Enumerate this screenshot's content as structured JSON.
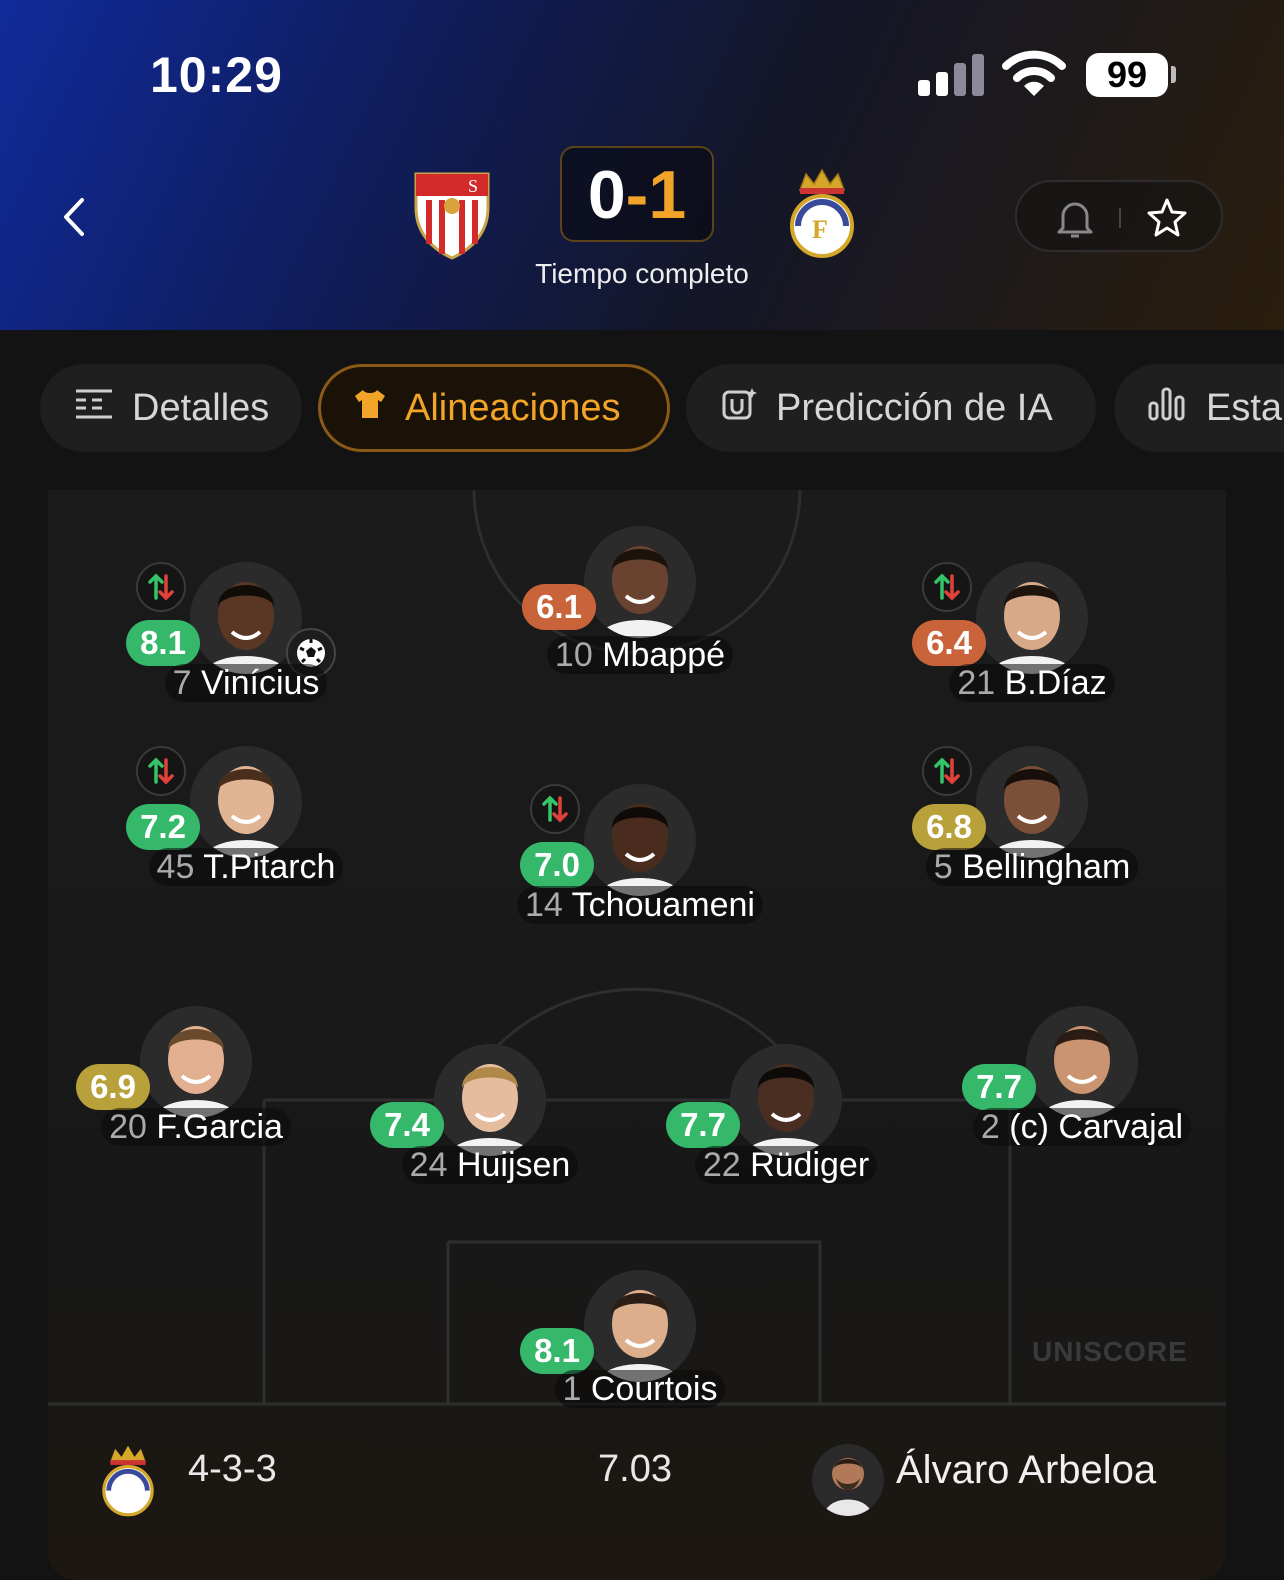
{
  "status_bar": {
    "time": "10:29",
    "battery": "99"
  },
  "match": {
    "home_team": "Sevilla",
    "away_team": "Real Madrid",
    "score_home": "0",
    "score_away": "1",
    "status": "Tiempo completo"
  },
  "tabs": [
    {
      "label": "Detalles",
      "icon": "list-icon",
      "active": false
    },
    {
      "label": "Alineaciones",
      "icon": "shirt-icon",
      "active": true
    },
    {
      "label": "Predicción de IA",
      "icon": "ai-icon",
      "active": false
    },
    {
      "label": "Esta",
      "icon": "bar-chart-icon",
      "active": false
    }
  ],
  "colors": {
    "accent": "#f2a428",
    "rating_green": "#35b86a",
    "rating_orange": "#c9643a",
    "rating_yellow": "#b8a03a"
  },
  "lineup": {
    "players": [
      {
        "id": "mbappe",
        "number": "10",
        "name": "Mbappé",
        "rating": "6.1",
        "rating_color": "orange",
        "sub": false,
        "goal": false
      },
      {
        "id": "vinicius",
        "number": "7",
        "name": "Vinícius",
        "rating": "8.1",
        "rating_color": "green",
        "sub": true,
        "goal": true
      },
      {
        "id": "bdiaz",
        "number": "21",
        "name": "B.Díaz",
        "rating": "6.4",
        "rating_color": "orange",
        "sub": true,
        "goal": false
      },
      {
        "id": "pitarch",
        "number": "45",
        "name": "T.Pitarch",
        "rating": "7.2",
        "rating_color": "green",
        "sub": true,
        "goal": false
      },
      {
        "id": "tchouameni",
        "number": "14",
        "name": "Tchouameni",
        "rating": "7.0",
        "rating_color": "green",
        "sub": true,
        "goal": false
      },
      {
        "id": "bellingham",
        "number": "5",
        "name": "Bellingham",
        "rating": "6.8",
        "rating_color": "yellow",
        "sub": true,
        "goal": false
      },
      {
        "id": "fgarcia",
        "number": "20",
        "name": "F.Garcia",
        "rating": "6.9",
        "rating_color": "yellow",
        "sub": false,
        "goal": false
      },
      {
        "id": "huijsen",
        "number": "24",
        "name": "Huijsen",
        "rating": "7.4",
        "rating_color": "green",
        "sub": false,
        "goal": false
      },
      {
        "id": "rudiger",
        "number": "22",
        "name": "Rüdiger",
        "rating": "7.7",
        "rating_color": "green",
        "sub": false,
        "goal": false
      },
      {
        "id": "carvajal",
        "number": "2",
        "name": "(c) Carvajal",
        "rating": "7.7",
        "rating_color": "green",
        "sub": false,
        "goal": false
      },
      {
        "id": "courtois",
        "number": "1",
        "name": "Courtois",
        "rating": "8.1",
        "rating_color": "green",
        "sub": false,
        "goal": false
      }
    ]
  },
  "watermark": "UNISCORE",
  "footer": {
    "formation": "4-3-3",
    "average_rating": "7.03",
    "coach": "Álvaro Arbeloa"
  }
}
